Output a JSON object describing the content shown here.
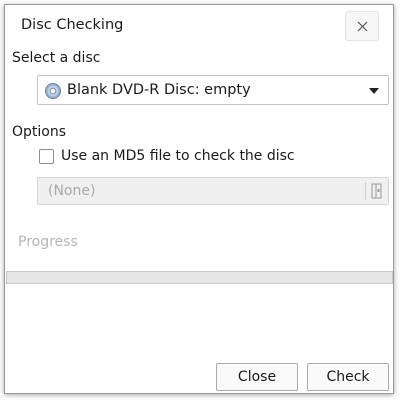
{
  "window": {
    "title": "Disc Checking"
  },
  "disc": {
    "section_label": "Select a disc",
    "selected": "Blank DVD-R Disc: empty",
    "icon": "disc-icon"
  },
  "options": {
    "section_label": "Options",
    "md5_checkbox_label": "Use an MD5 file to check the disc",
    "md5_checked": false,
    "md5_file_value": "(None)",
    "browse_icon": "file-browse-icon"
  },
  "progress": {
    "label": "Progress",
    "percent": 0
  },
  "buttons": {
    "close": "Close",
    "check": "Check"
  }
}
